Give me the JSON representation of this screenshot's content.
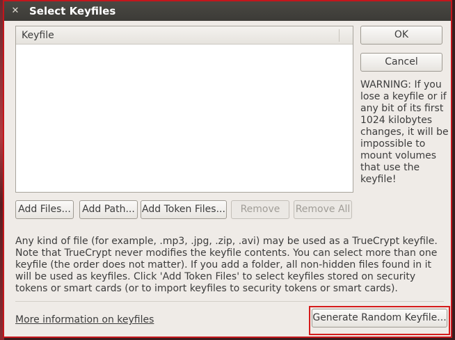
{
  "window": {
    "title": "Select Keyfiles",
    "close_glyph": "✕"
  },
  "keyfile_list": {
    "column_header": "Keyfile",
    "rows": []
  },
  "buttons": {
    "ok": "OK",
    "cancel": "Cancel",
    "add_files": "Add Files...",
    "add_path": "Add Path...",
    "add_token_files": "Add Token Files...",
    "remove": "Remove",
    "remove_all": "Remove All",
    "generate_random_keyfile": "Generate Random Keyfile..."
  },
  "warning_text": "WARNING: If you lose a keyfile or if any bit of its first 1024 kilobytes changes, it will be impossible to mount volumes that use the keyfile!",
  "description_text": "Any kind of file (for example, .mp3, .jpg, .zip, .avi) may be used as a TrueCrypt keyfile. Note that TrueCrypt never modifies the keyfile contents. You can select more than one keyfile (the order does not matter). If you add a folder, all non-hidden files found in it will be used as keyfiles. Click 'Add Token Files' to select keyfiles stored on security tokens or smart cards (or to import keyfiles to security tokens or smart cards).",
  "more_info_link": "More information on keyfiles",
  "colors": {
    "highlight": "#d51b1b",
    "window_border": "#c4161c",
    "titlebar": "#3c3b37"
  }
}
